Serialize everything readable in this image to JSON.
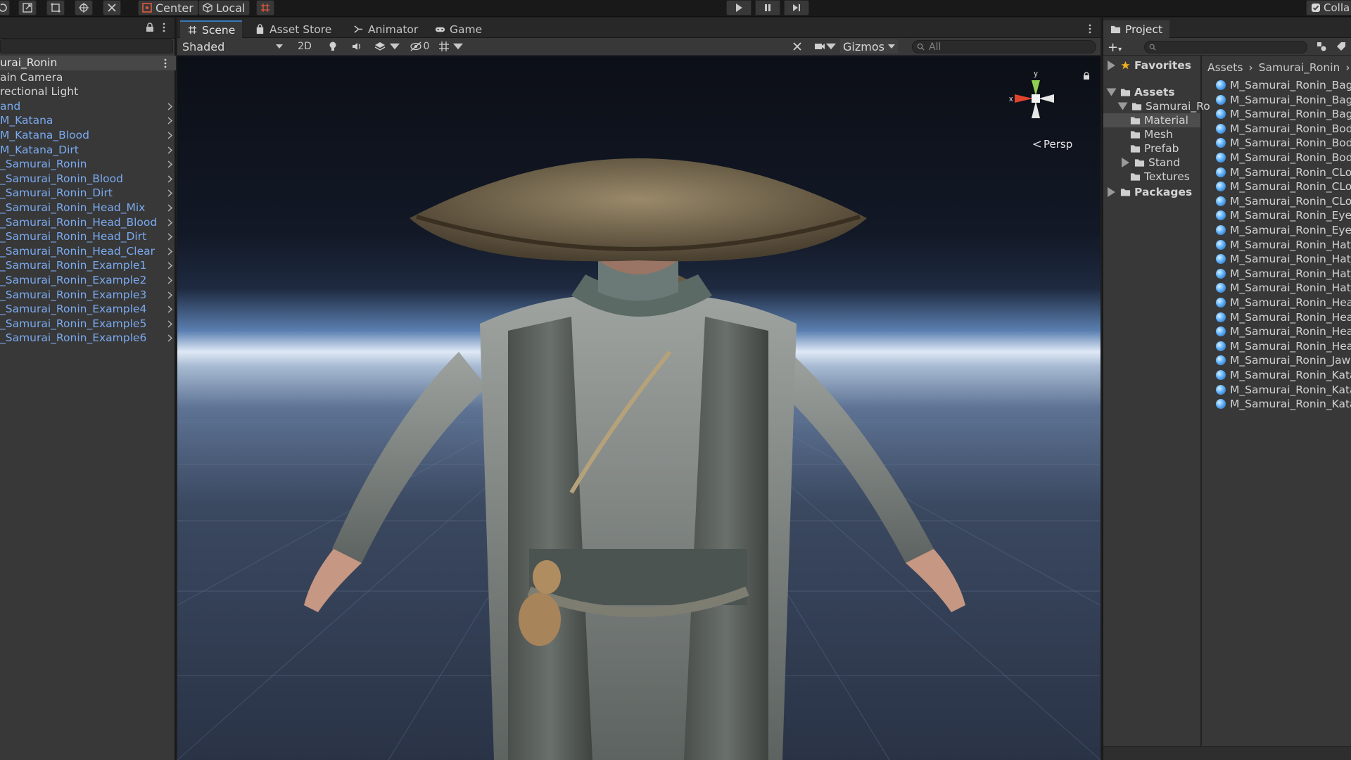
{
  "toolbar": {
    "pivot_label": "Center",
    "space_label": "Local",
    "collab_label": "Colla"
  },
  "hierarchy": {
    "root": "urai_Ronin",
    "items": [
      {
        "label": "ain Camera",
        "type": "plain",
        "expandable": false
      },
      {
        "label": "rectional Light",
        "type": "plain",
        "expandable": false
      },
      {
        "label": "and",
        "type": "prefab",
        "expandable": true
      },
      {
        "label": "M_Katana",
        "type": "prefab",
        "expandable": true
      },
      {
        "label": "M_Katana_Blood",
        "type": "prefab",
        "expandable": true
      },
      {
        "label": "M_Katana_Dirt",
        "type": "prefab",
        "expandable": true
      },
      {
        "label": "_Samurai_Ronin",
        "type": "prefab",
        "expandable": true
      },
      {
        "label": "_Samurai_Ronin_Blood",
        "type": "prefab",
        "expandable": true
      },
      {
        "label": "_Samurai_Ronin_Dirt",
        "type": "prefab",
        "expandable": true
      },
      {
        "label": "_Samurai_Ronin_Head_Mix",
        "type": "prefab",
        "expandable": true
      },
      {
        "label": "_Samurai_Ronin_Head_Blood",
        "type": "prefab",
        "expandable": true
      },
      {
        "label": "_Samurai_Ronin_Head_Dirt",
        "type": "prefab",
        "expandable": true
      },
      {
        "label": "_Samurai_Ronin_Head_Clear",
        "type": "prefab",
        "expandable": true
      },
      {
        "label": "_Samurai_Ronin_Example1",
        "type": "prefab",
        "expandable": true
      },
      {
        "label": "_Samurai_Ronin_Example2",
        "type": "prefab",
        "expandable": true
      },
      {
        "label": "_Samurai_Ronin_Example3",
        "type": "prefab",
        "expandable": true
      },
      {
        "label": "_Samurai_Ronin_Example4",
        "type": "prefab",
        "expandable": true
      },
      {
        "label": "_Samurai_Ronin_Example5",
        "type": "prefab",
        "expandable": true
      },
      {
        "label": "_Samurai_Ronin_Example6",
        "type": "prefab",
        "expandable": true
      }
    ]
  },
  "scene": {
    "tabs": [
      {
        "label": "Scene",
        "icon": "scene-grid-icon",
        "active": true
      },
      {
        "label": "Asset Store",
        "icon": "asset-store-bag-icon",
        "active": false
      },
      {
        "label": "Animator",
        "icon": "animator-icon",
        "active": false
      },
      {
        "label": "Game",
        "icon": "game-controller-icon",
        "active": false
      }
    ],
    "draw_mode": "Shaded",
    "mode_2d": "2D",
    "hidden_count": "0",
    "gizmos_label": "Gizmos",
    "search_placeholder": "All",
    "axis_y": "y",
    "axis_x": "x",
    "projection": "Persp"
  },
  "project": {
    "tab_label": "Project",
    "tree": {
      "favorites": "Favorites",
      "assets": "Assets",
      "samurai_folder": "Samurai_Ro",
      "subfolders": [
        "Material",
        "Mesh",
        "Prefab",
        "Stand",
        "Textures"
      ],
      "packages": "Packages"
    },
    "breadcrumb": [
      "Assets",
      "Samurai_Ronin"
    ],
    "files": [
      "M_Samurai_Ronin_Bag",
      "M_Samurai_Ronin_Bag_",
      "M_Samurai_Ronin_Bag_",
      "M_Samurai_Ronin_Body",
      "M_Samurai_Ronin_Body",
      "M_Samurai_Ronin_Body",
      "M_Samurai_Ronin_CLot",
      "M_Samurai_Ronin_CLot",
      "M_Samurai_Ronin_CLot",
      "M_Samurai_Ronin_Eyel",
      "M_Samurai_Ronin_Eyes",
      "M_Samurai_Ronin_Hat",
      "M_Samurai_Ronin_Hat_",
      "M_Samurai_Ronin_Hat_",
      "M_Samurai_Ronin_Hat_",
      "M_Samurai_Ronin_Head",
      "M_Samurai_Ronin_Head",
      "M_Samurai_Ronin_Head",
      "M_Samurai_Ronin_Head",
      "M_Samurai_Ronin_Jaw",
      "M_Samurai_Ronin_Kata",
      "M_Samurai_Ronin_Kata",
      "M_Samurai_Ronin_Kata"
    ]
  },
  "colors": {
    "accent": "#3a79bb",
    "prefab_text": "#7aaaf0",
    "panel_bg": "#383838",
    "tab_bar": "#282828"
  }
}
